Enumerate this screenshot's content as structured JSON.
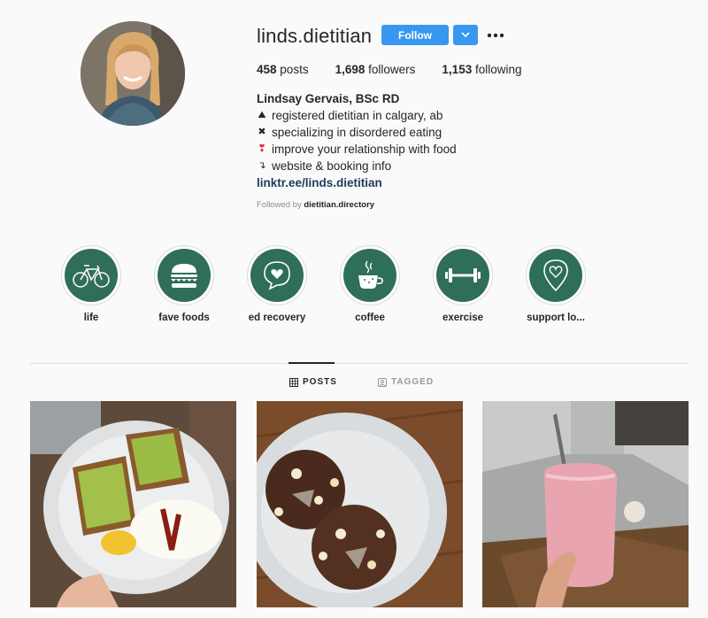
{
  "profile": {
    "username": "linds.dietitian",
    "follow_label": "Follow",
    "more_icon": "ellipsis-icon",
    "dropdown_icon": "chevron-down-icon"
  },
  "stats": {
    "posts_count": "458",
    "posts_label": "posts",
    "followers_count": "1,698",
    "followers_label": "followers",
    "following_count": "1,153",
    "following_label": "following"
  },
  "bio": {
    "name": "Lindsay Gervais, BSc RD",
    "lines": [
      {
        "emoji": "⛰",
        "text": "registered dietitian in calgary, ab"
      },
      {
        "emoji": "✖",
        "text": "specializing in disordered eating"
      },
      {
        "emoji": "❣",
        "text": "improve your relationship with food"
      },
      {
        "emoji": "↴",
        "text": "website & booking info"
      }
    ],
    "link": "linktr.ee/linds.dietitian",
    "followed_by_prefix": "Followed by",
    "followed_by_user": "dietitian.directory"
  },
  "highlights": [
    {
      "label": "life",
      "icon": "bicycle-icon"
    },
    {
      "label": "fave foods",
      "icon": "burger-icon"
    },
    {
      "label": "ed recovery",
      "icon": "heart-chat-icon"
    },
    {
      "label": "coffee",
      "icon": "coffee-cup-icon"
    },
    {
      "label": "exercise",
      "icon": "dumbbell-icon"
    },
    {
      "label": "support lo...",
      "icon": "location-heart-icon"
    }
  ],
  "tabs": [
    {
      "label": "POSTS",
      "icon": "grid-icon",
      "active": true
    },
    {
      "label": "TAGGED",
      "icon": "tag-icon",
      "active": false
    }
  ],
  "colors": {
    "accent": "#3897f0",
    "highlight_bg": "#2f6e57",
    "link": "#1f3b5e"
  }
}
